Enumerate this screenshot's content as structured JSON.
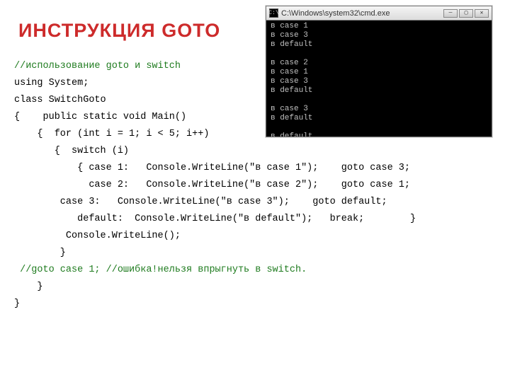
{
  "title": "ИНСТРУКЦИЯ GOTO",
  "code": {
    "l1": "//использование goto и switch",
    "l2": "using System;",
    "l3": "class SwitchGoto",
    "l4": "{    public static void Main()",
    "l5": "    {  for (int i = 1; i < 5; i++)",
    "l6": "       {  switch (i)",
    "l7": "           { case 1:   Console.WriteLine(\"в case 1\");    goto case 3;",
    "l8": "             case 2:   Console.WriteLine(\"в case 2\");    goto case 1;",
    "l9": "        case 3:   Console.WriteLine(\"в case 3\");    goto default;",
    "l10": "           default:  Console.WriteLine(\"в default\");   break;        }",
    "l11": "         Console.WriteLine();",
    "l12": "        }",
    "l13": " //goto case 1; //ошибка!нельзя впрыгнуть в switch.",
    "l14": "    }",
    "l15": "}"
  },
  "console": {
    "titlebar": "C:\\Windows\\system32\\cmd.exe",
    "icon": "C:\\",
    "output": "в case 1\nв case 3\nв default\n\nв case 2\nв case 1\nв case 3\nв default\n\nв case 3\nв default\n\nв default"
  }
}
